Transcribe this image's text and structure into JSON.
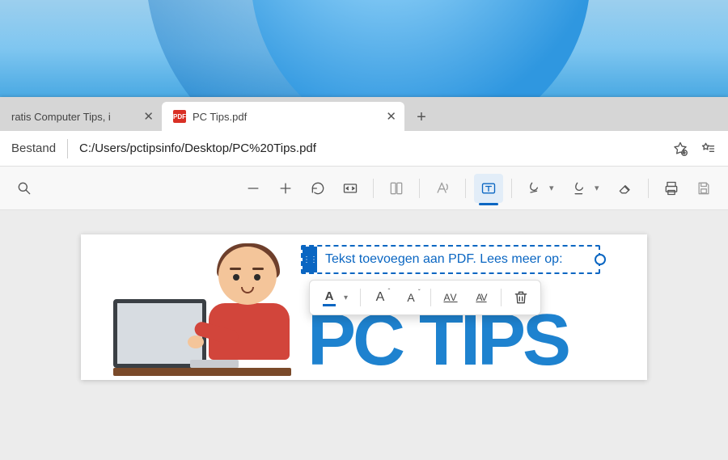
{
  "tabs": {
    "inactive_title": "ratis Computer Tips, i",
    "active_title": "PC Tips.pdf",
    "active_favicon_label": "PDF"
  },
  "addressbar": {
    "file_label": "Bestand",
    "url": "C:/Users/pctipsinfo/Desktop/PC%20Tips.pdf"
  },
  "document": {
    "big_text": "PC TIPS",
    "inserted_text": "Tekst toevoegen aan PDF. Lees meer op:"
  },
  "colors": {
    "accent": "#0a66c2"
  }
}
